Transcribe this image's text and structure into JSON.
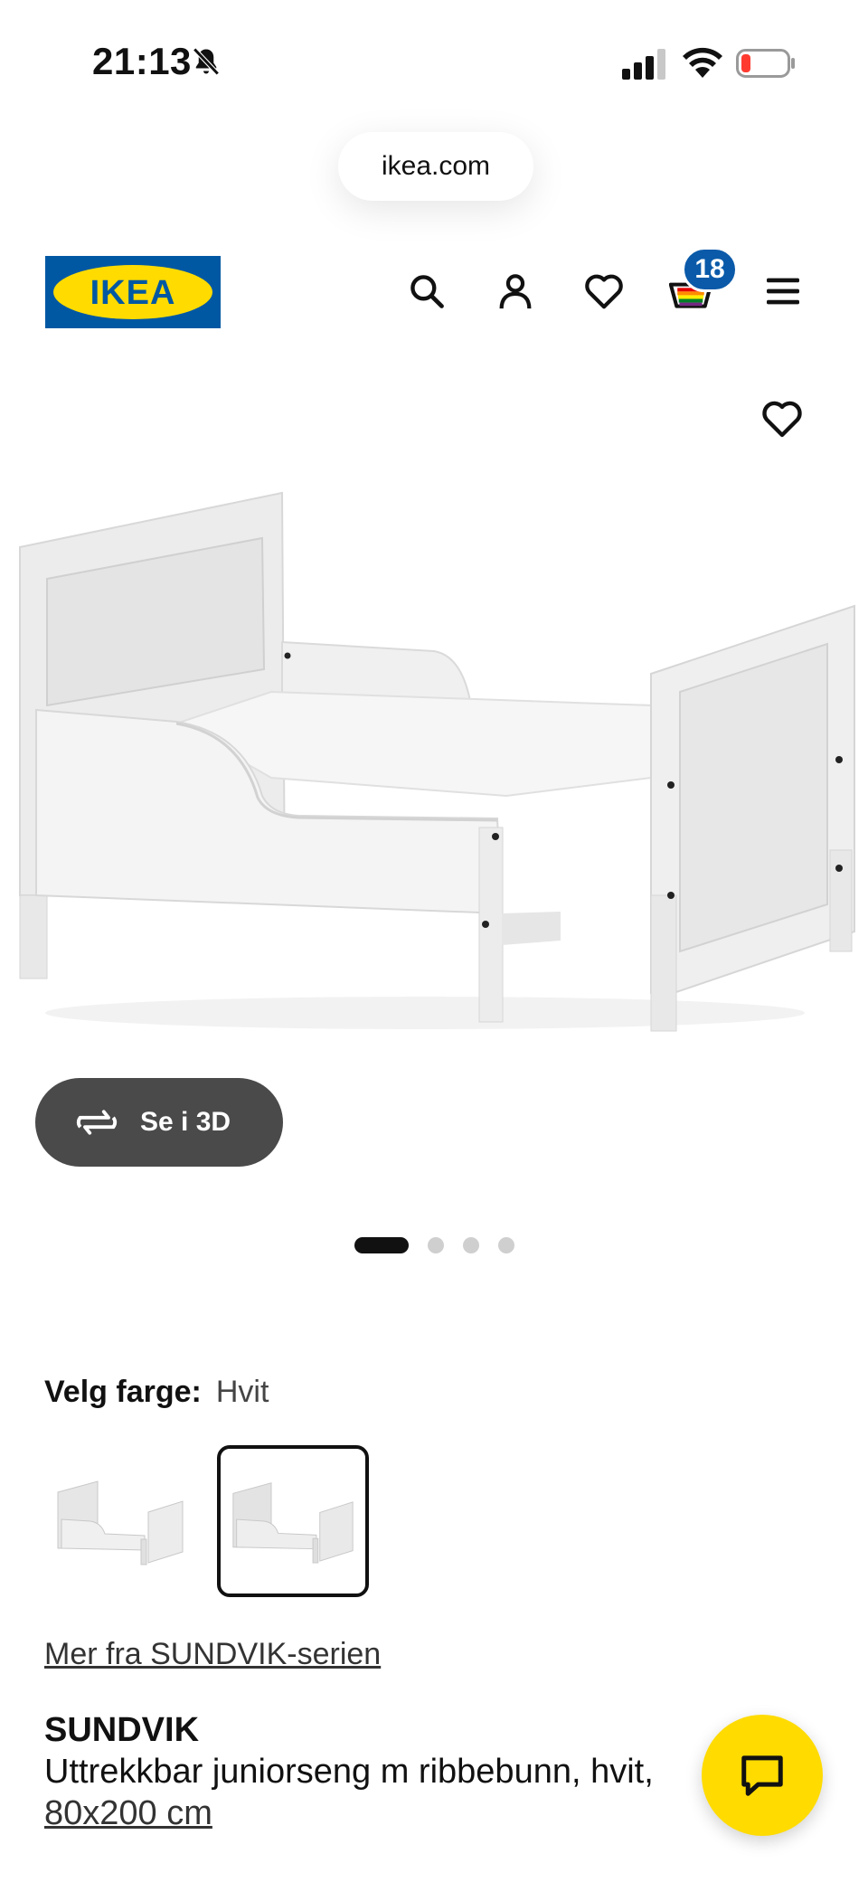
{
  "status_bar": {
    "time": "21:13",
    "icons": [
      "bell-muted-icon",
      "signal-icon",
      "wifi-icon",
      "battery-low-icon"
    ]
  },
  "browser": {
    "url": "ikea.com"
  },
  "header": {
    "logo_text": "IKEA",
    "brand_colors": {
      "blue": "#0058a3",
      "yellow": "#ffdb00"
    },
    "icons": [
      "search-icon",
      "profile-icon",
      "heart-icon",
      "cart-icon",
      "menu-icon"
    ],
    "cart_count": "18"
  },
  "gallery": {
    "view_3d_label": "Se i 3D",
    "slide_count": 4,
    "active_slide": 1
  },
  "color_selection": {
    "label": "Velg farge:",
    "value": "Hvit",
    "selected_swatch": 2
  },
  "product": {
    "series_link": "Mer fra SUNDVIK-serien",
    "name": "SUNDVIK",
    "description": "Uttrekkbar juniorseng m ribbebunn, hvit,",
    "size": "80x200 cm"
  },
  "chat": {
    "icon": "chat-icon",
    "color": "#ffdb00"
  }
}
